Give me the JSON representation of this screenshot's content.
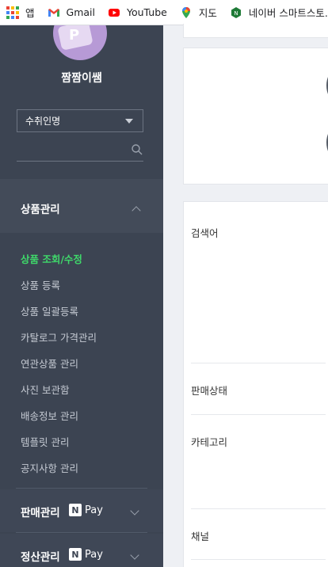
{
  "bookmarks": [
    {
      "label": "앱",
      "icon": "apps-grid-icon"
    },
    {
      "label": "Gmail",
      "icon": "gmail-icon"
    },
    {
      "label": "YouTube",
      "icon": "youtube-icon"
    },
    {
      "label": "지도",
      "icon": "maps-pin-icon"
    },
    {
      "label": "네이버 스마트스토...",
      "icon": "naver-smartstore-icon"
    }
  ],
  "sidebar": {
    "username": "짬짬이쌤",
    "select": {
      "value": "수취인명",
      "icon": "caret-down-icon"
    },
    "search": {
      "value": "",
      "placeholder": "",
      "icon": "search-icon"
    },
    "category": {
      "title": "상품관리",
      "icon": "chevron-up-icon"
    },
    "submenu": [
      {
        "label": "상품 조회/수정",
        "active": true
      },
      {
        "label": "상품 등록",
        "active": false
      },
      {
        "label": "상품 일괄등록",
        "active": false
      },
      {
        "label": "카탈로그 가격관리",
        "active": false
      },
      {
        "label": "연관상품 관리",
        "active": false
      },
      {
        "label": "사진 보관함",
        "active": false
      },
      {
        "label": "배송정보 관리",
        "active": false
      },
      {
        "label": "템플릿 관리",
        "active": false
      },
      {
        "label": "공지사항 관리",
        "active": false
      }
    ],
    "sections": [
      {
        "title": "판매관리",
        "badge_letter": "N",
        "badge_text": "Pay",
        "icon": "chevron-down-icon"
      },
      {
        "title": "정산관리",
        "badge_letter": "N",
        "badge_text": "Pay",
        "icon": "chevron-down-icon"
      }
    ]
  },
  "main": {
    "form_labels": [
      "검색어",
      "판매상태",
      "카테고리",
      "채널"
    ]
  },
  "colors": {
    "sidebar_bg": "#3c4452",
    "active_menu": "#3fd86a",
    "main_bg": "#eef0f4"
  }
}
